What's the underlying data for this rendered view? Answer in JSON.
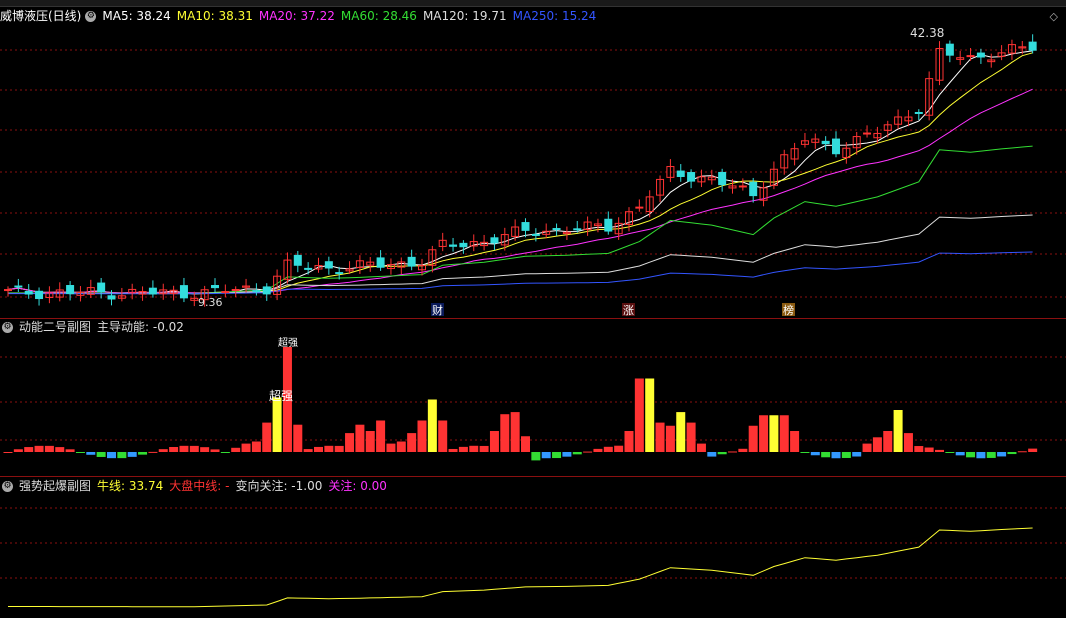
{
  "main": {
    "title": "威博液压(日线)",
    "ma": [
      {
        "label": "MA5: 38.24",
        "color": "#ffffff"
      },
      {
        "label": "MA10: 38.31",
        "color": "#ffff33"
      },
      {
        "label": "MA20: 37.22",
        "color": "#ff33ff"
      },
      {
        "label": "MA60: 28.46",
        "color": "#33dd33"
      },
      {
        "label": "MA120: 19.71",
        "color": "#dddddd"
      },
      {
        "label": "MA250: 15.24",
        "color": "#3355ff"
      }
    ],
    "high_label": "42.38",
    "low_label": "9.36",
    "markers": [
      {
        "text": "财",
        "bg": "#0a1a5a",
        "color": "#ffffff"
      },
      {
        "text": "涨",
        "bg": "#5a1010",
        "color": "#ffffff"
      },
      {
        "text": "榜",
        "bg": "#8a5a10",
        "color": "#ffffff"
      }
    ]
  },
  "sub1": {
    "title": "动能二号副图",
    "value_label": "主导动能: -0.02",
    "annot_top": "超强",
    "annot_mid": "超强"
  },
  "sub2": {
    "title": "强势起爆副图",
    "items": [
      {
        "label": "牛线: 33.74",
        "color": "#ffff33"
      },
      {
        "label": "大盘中线: -",
        "color": "#ff3333"
      },
      {
        "label": "变向关注: -1.00",
        "color": "#dddddd"
      },
      {
        "label": "关注: 0.00",
        "color": "#ff33ff"
      }
    ]
  },
  "colors": {
    "up": "#ff3333",
    "down": "#33dddd",
    "grid": "#8a1010"
  }
}
